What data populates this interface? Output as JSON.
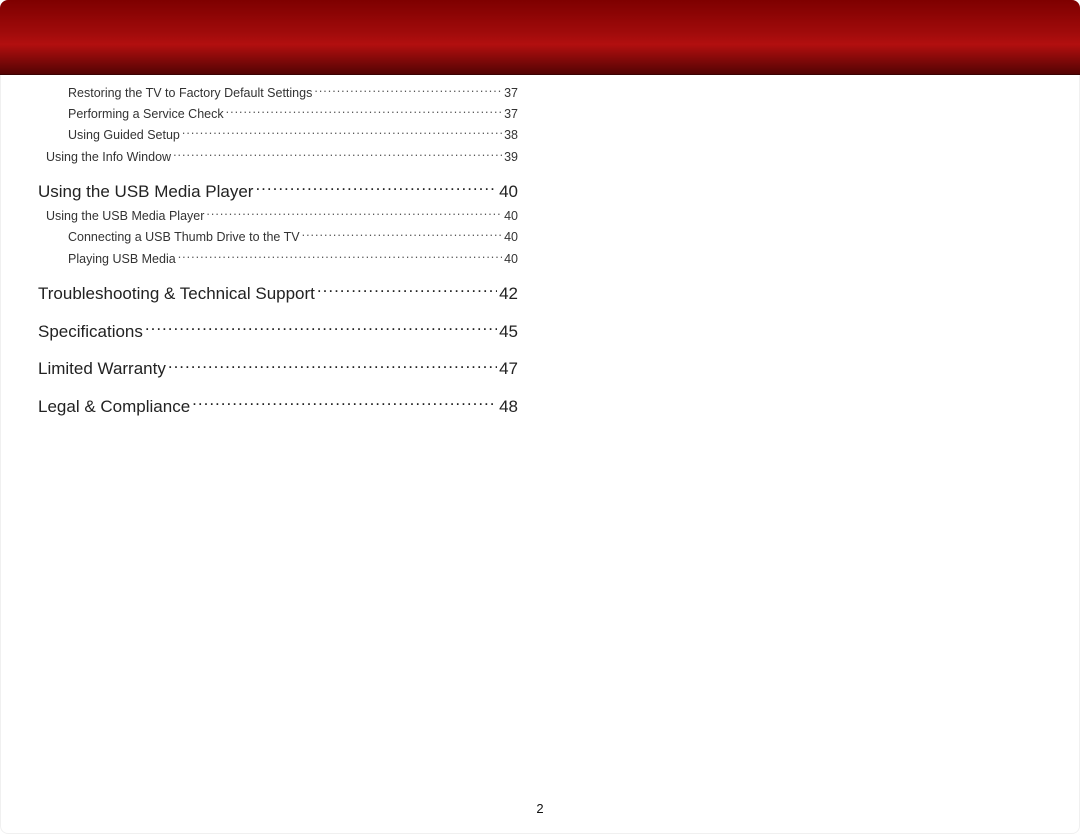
{
  "toc": [
    {
      "level": 2,
      "title": "Restoring the TV to Factory Default Settings",
      "page": "37"
    },
    {
      "level": 2,
      "title": "Performing a Service Check",
      "page": "37"
    },
    {
      "level": 2,
      "title": "Using Guided Setup",
      "page": "38"
    },
    {
      "level": 1,
      "title": "Using the Info Window",
      "page": "39"
    },
    {
      "level": 0,
      "title": "Using the USB Media Player",
      "page": "40"
    },
    {
      "level": 1,
      "title": "Using the USB Media Player",
      "page": "40"
    },
    {
      "level": 2,
      "title": "Connecting a USB Thumb Drive to the TV",
      "page": "40"
    },
    {
      "level": 2,
      "title": "Playing USB Media",
      "page": "40"
    },
    {
      "level": 0,
      "title": "Troubleshooting & Technical Support",
      "page": "42"
    },
    {
      "level": 0,
      "title": "Specifications",
      "page": "45"
    },
    {
      "level": 0,
      "title": "Limited Warranty",
      "page": "47"
    },
    {
      "level": 0,
      "title": "Legal & Compliance",
      "page": "48"
    }
  ],
  "page_number": "2"
}
